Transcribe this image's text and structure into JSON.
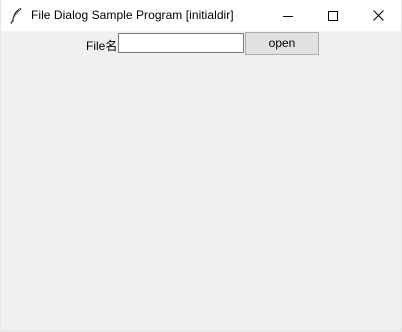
{
  "window": {
    "title": "File Dialog Sample Program [initialdir]",
    "icon": "feather-icon",
    "controls": {
      "minimize_icon": "minimize-icon",
      "maximize_icon": "maximize-icon",
      "close_icon": "close-icon"
    }
  },
  "form": {
    "file_label": "File名",
    "file_input_value": "",
    "open_button_label": "open"
  },
  "colors": {
    "titlebar_bg": "#ffffff",
    "window_bg": "#f0f0f0",
    "button_bg": "#e1e1e1",
    "button_border": "#adadad",
    "input_border": "#7a7a7a"
  }
}
